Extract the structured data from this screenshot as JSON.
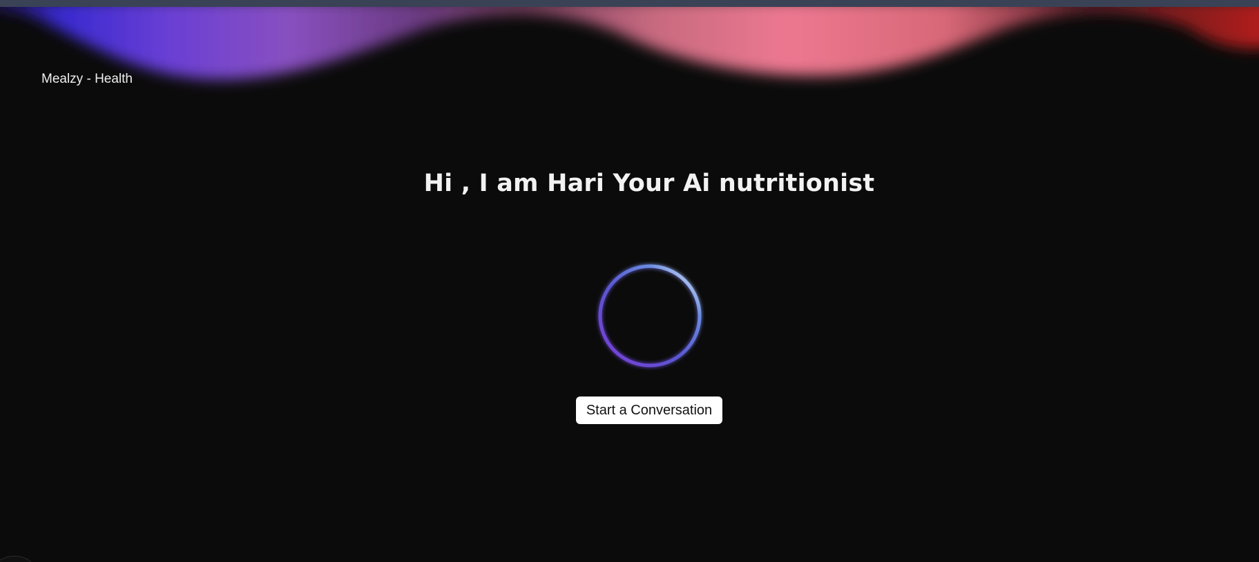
{
  "app": {
    "brand": "Mealzy - Health"
  },
  "hero": {
    "headline": "Hi , I am Hari Your Ai nutritionist",
    "cta_label": "Start a Conversation"
  },
  "colors": {
    "background": "#0b0b0b",
    "wave_blue": "#3a2ad0",
    "wave_purple": "#7a44c8",
    "wave_pink": "#e07088",
    "wave_red": "#b02020",
    "orb_purple": "#8a4ee0",
    "orb_cyan": "#cdeeff"
  }
}
